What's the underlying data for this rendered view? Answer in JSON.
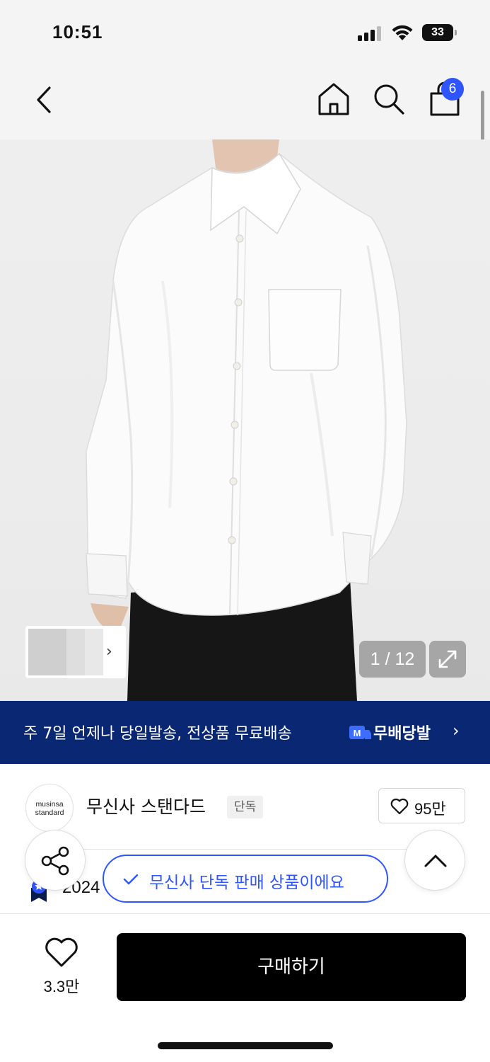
{
  "status_bar": {
    "time": "10:51",
    "battery": "33"
  },
  "header": {
    "cart_count": "6"
  },
  "gallery": {
    "counter": "1 / 12"
  },
  "banner": {
    "text": "주 7일 언제나 당일발송, 전상품 무료배송",
    "logo_letter": "M",
    "brand": "무배당발",
    "chevron": "›"
  },
  "brand": {
    "logo_line1": "musinsa",
    "logo_line2": "standard",
    "name": "무신사 스탠다드",
    "tag": "단독",
    "likes": "95만"
  },
  "info": {
    "year_partial": "2024"
  },
  "exclusive_notice": "무신사 단독 판매 상품이에요",
  "actions": {
    "wish_count": "3.3만",
    "buy_label": "구매하기"
  },
  "colors": {
    "accent_blue": "#2f55ff",
    "banner_navy": "#0a2774",
    "buy_black": "#000000"
  }
}
